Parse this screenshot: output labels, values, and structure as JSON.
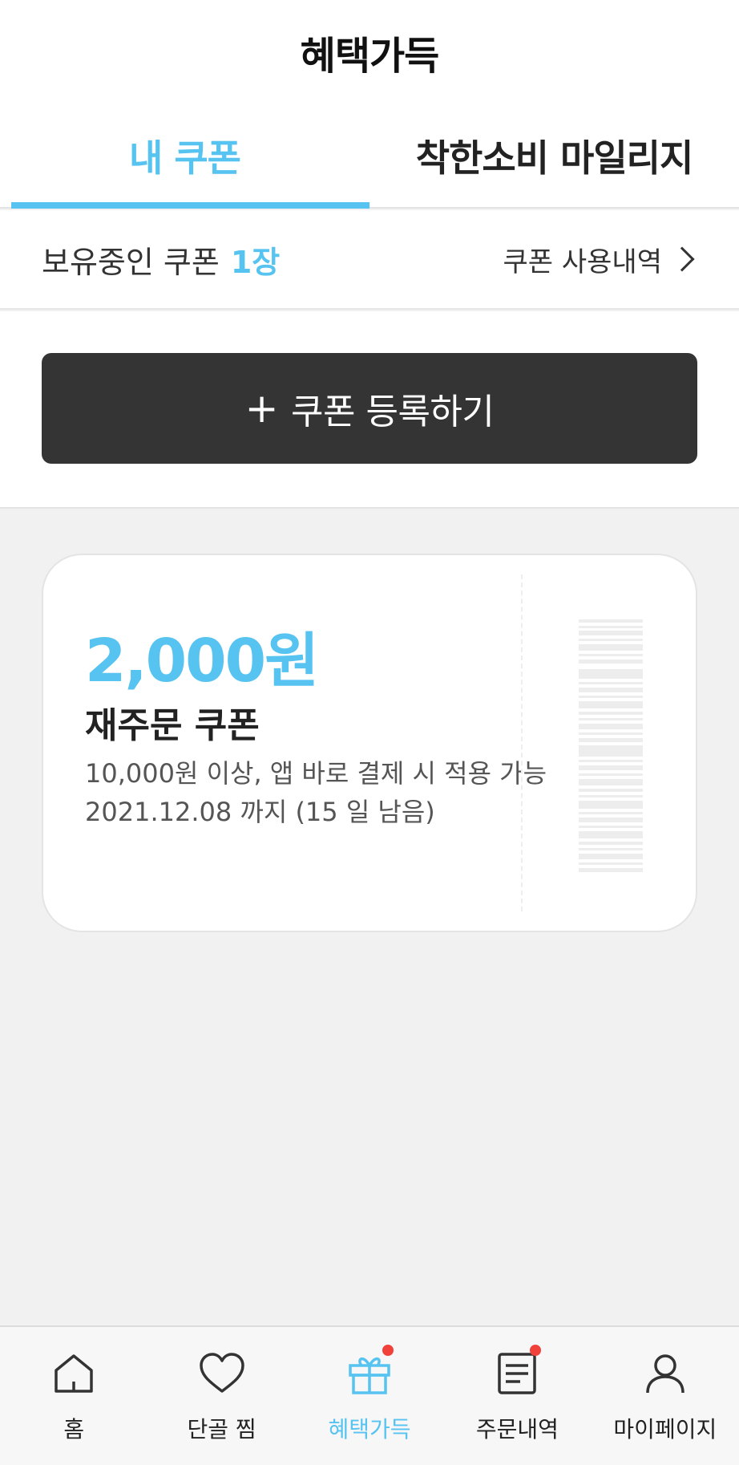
{
  "header": {
    "title": "혜택가득"
  },
  "tabs": [
    {
      "label": "내 쿠폰",
      "active": true
    },
    {
      "label": "착한소비 마일리지",
      "active": false
    }
  ],
  "coupon_summary": {
    "label": "보유중인 쿠폰",
    "count": "1장",
    "history_link": "쿠폰 사용내역"
  },
  "register_button": {
    "label": "쿠폰 등록하기"
  },
  "coupons": [
    {
      "amount": "2,000원",
      "name": "재주문 쿠폰",
      "condition": "10,000원 이상, 앱 바로 결제 시 적용 가능",
      "expiry": "2021.12.08 까지 (15 일 남음)"
    }
  ],
  "bottom_nav": [
    {
      "label": "홈",
      "icon": "home-icon",
      "active": false,
      "badge": false
    },
    {
      "label": "단골 찜",
      "icon": "heart-icon",
      "active": false,
      "badge": false
    },
    {
      "label": "혜택가득",
      "icon": "gift-icon",
      "active": true,
      "badge": true
    },
    {
      "label": "주문내역",
      "icon": "receipt-icon",
      "active": false,
      "badge": true
    },
    {
      "label": "마이페이지",
      "icon": "person-icon",
      "active": false,
      "badge": false
    }
  ],
  "colors": {
    "accent": "#56c3f0",
    "button_dark": "#343434",
    "badge": "#f0413a",
    "background": "#f1f1f1"
  }
}
